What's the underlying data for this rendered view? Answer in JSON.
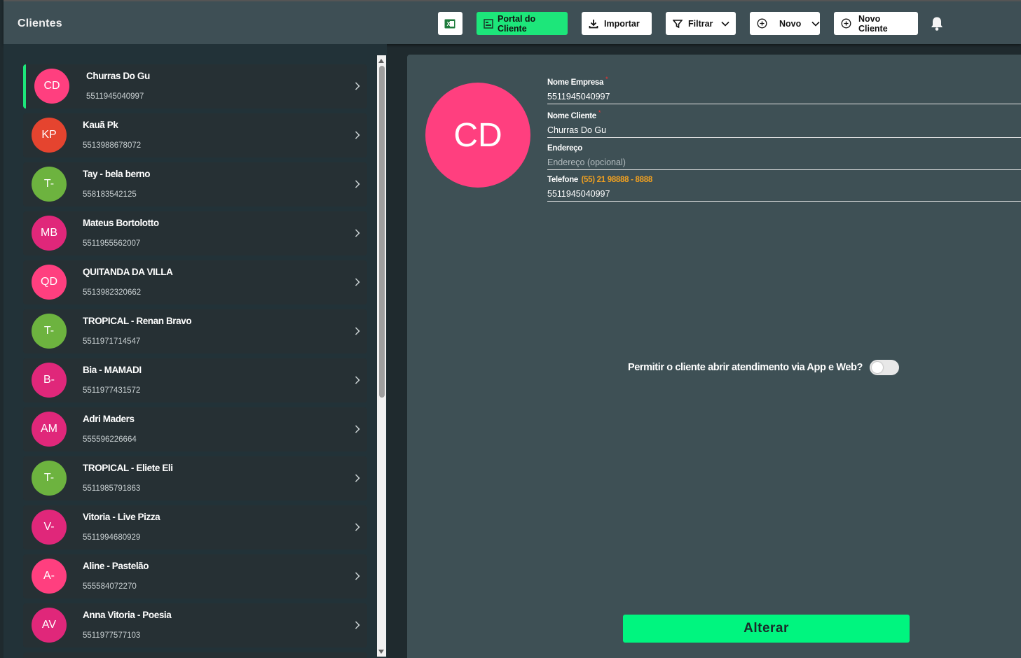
{
  "header": {
    "title": "Clientes",
    "portal_label": "Portal do Cliente",
    "importar_label": "Importar",
    "filtrar_label": "Filtrar",
    "novo_label": "Novo",
    "novo_cliente_label": "Novo Cliente"
  },
  "clients": [
    {
      "initials": "CD",
      "name": "Churras Do Gu",
      "phone": "5511945040997",
      "color": "#ff3f7f"
    },
    {
      "initials": "KP",
      "name": "Kauã Pk",
      "phone": "5513988678072",
      "color": "#e5442f"
    },
    {
      "initials": "T-",
      "name": "Tay - bela berno",
      "phone": "558183542125",
      "color": "#6db33f"
    },
    {
      "initials": "MB",
      "name": "Mateus Bortolotto",
      "phone": "5511955562007",
      "color": "#e0277a"
    },
    {
      "initials": "QD",
      "name": "QUITANDA DA VILLA",
      "phone": "5513982320662",
      "color": "#ff3f7f"
    },
    {
      "initials": "T-",
      "name": "TROPICAL - Renan Bravo",
      "phone": "5511971714547",
      "color": "#6db33f"
    },
    {
      "initials": "B-",
      "name": "Bia - MAMADI",
      "phone": "5511977431572",
      "color": "#e0277a"
    },
    {
      "initials": "AM",
      "name": "Adri Maders",
      "phone": "555596226664",
      "color": "#e0277a"
    },
    {
      "initials": "T-",
      "name": "TROPICAL - Eliete Eli",
      "phone": "5511985791863",
      "color": "#6db33f"
    },
    {
      "initials": "V-",
      "name": "Vitoria - Live Pizza",
      "phone": "5511994680929",
      "color": "#e0277a"
    },
    {
      "initials": "A-",
      "name": "Aline - Pastelão",
      "phone": "555584072270",
      "color": "#ff3f7f"
    },
    {
      "initials": "AV",
      "name": "Anna Vitoria - Poesia",
      "phone": "5511977577103",
      "color": "#e0277a"
    }
  ],
  "detail": {
    "avatar_initials": "CD",
    "empresa_label": "Nome Empresa",
    "empresa_value": "5511945040997",
    "cliente_label": "Nome Cliente",
    "cliente_value": "Churras Do Gu",
    "endereco_label": "Endereço",
    "endereco_placeholder": "Endereço (opcional)",
    "telefone_label": "Telefone",
    "telefone_hint": "(55) 21 98888 - 8888",
    "telefone_value": "5511945040997",
    "required_mark": "*",
    "toggle_label": "Permitir o cliente abrir atendimento via App e Web?",
    "toggle_on": false,
    "submit_label": "Alterar"
  },
  "colors": {
    "accent": "#1de67a",
    "header_bg": "#3e4f55",
    "panel_bg": "#3e5055",
    "list_bg": "#223238",
    "item_bg": "#263034",
    "hint": "#f0a020",
    "avatar_main": "#ff3f7f"
  },
  "icons": [
    "excel-icon",
    "portal-icon",
    "download-icon",
    "filter-icon",
    "chevron-down-icon",
    "plus-circle-icon",
    "bell-icon",
    "chevron-right-icon"
  ]
}
